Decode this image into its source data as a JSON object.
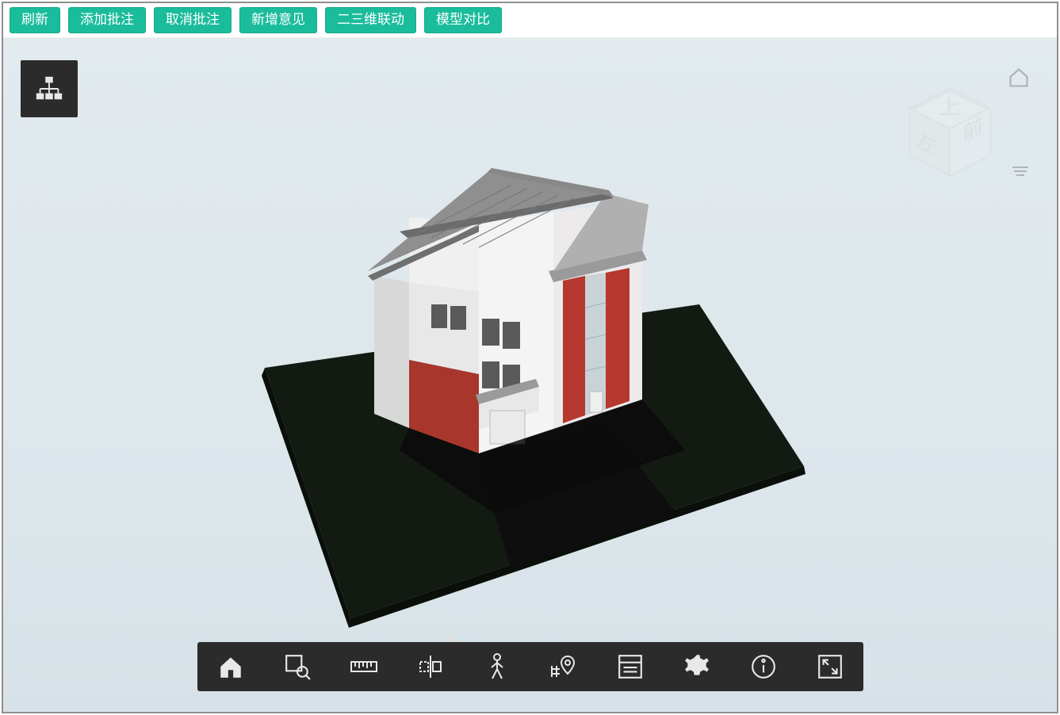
{
  "toolbar": {
    "refresh": "刷新",
    "add_annotation": "添加批注",
    "cancel_annotation": "取消批注",
    "new_comment": "新增意见",
    "link_2d3d": "二三维联动",
    "model_compare": "模型对比"
  },
  "viewcube": {
    "face_top": "上",
    "face_left": "左",
    "face_front": "前"
  },
  "tools": {
    "tree": "model-tree",
    "home": "home",
    "zoom_region": "zoom-region",
    "measure": "measure",
    "section": "section",
    "walk": "walk",
    "map_pin": "map-pin",
    "properties": "properties",
    "settings": "settings",
    "info": "info",
    "fullscreen": "fullscreen"
  }
}
